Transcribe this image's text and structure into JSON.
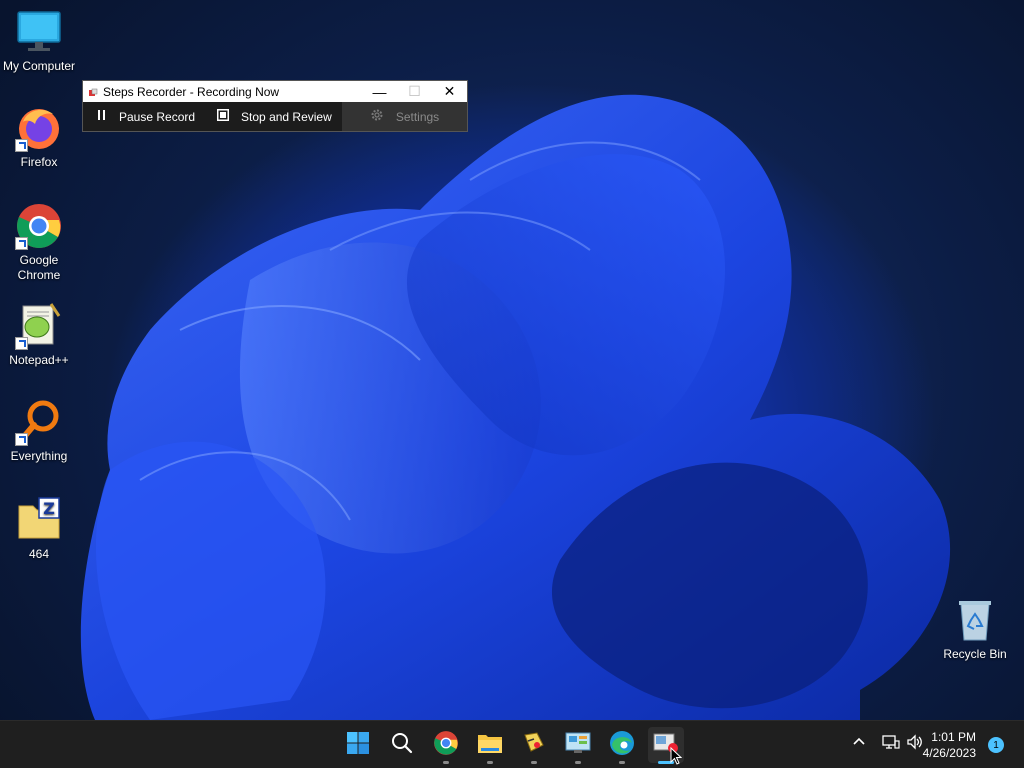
{
  "desktop": {
    "icons": [
      {
        "label": "My Computer",
        "icon": "computer-icon"
      },
      {
        "label": "Firefox",
        "icon": "firefox-icon"
      },
      {
        "label": "Google Chrome",
        "icon": "chrome-icon"
      },
      {
        "label": "Notepad++",
        "icon": "notepadpp-icon"
      },
      {
        "label": "Everything",
        "icon": "everything-search-icon"
      },
      {
        "label": "464",
        "icon": "zip-folder-icon"
      },
      {
        "label": "Recycle Bin",
        "icon": "recycle-bin-icon"
      }
    ]
  },
  "steps_recorder": {
    "title": "Steps Recorder - Recording Now",
    "pause_label": "Pause Record",
    "stop_label": "Stop and Review",
    "settings_label": "Settings",
    "minimize_glyph": "—",
    "maximize_glyph": "☐",
    "close_glyph": "✕"
  },
  "taskbar": {
    "apps": [
      {
        "name": "start",
        "icon": "windows-start-icon"
      },
      {
        "name": "search",
        "icon": "search-icon"
      },
      {
        "name": "chrome",
        "icon": "chrome-icon",
        "running": true
      },
      {
        "name": "file-explorer",
        "icon": "folder-icon",
        "running": true
      },
      {
        "name": "app-yellow",
        "icon": "paint-app-icon",
        "running": true
      },
      {
        "name": "control-panel",
        "icon": "control-panel-icon",
        "running": true
      },
      {
        "name": "edge",
        "icon": "edge-icon",
        "running": true
      },
      {
        "name": "steps-recorder",
        "icon": "steps-recorder-icon",
        "active": true
      }
    ],
    "tray": {
      "time": "1:01 PM",
      "date": "4/26/2023",
      "notification_count": "1"
    }
  },
  "colors": {
    "accent": "#4cc2ff",
    "wallpaper_blue": "#1e4cf0",
    "taskbar_bg": "#1f1f1f"
  }
}
